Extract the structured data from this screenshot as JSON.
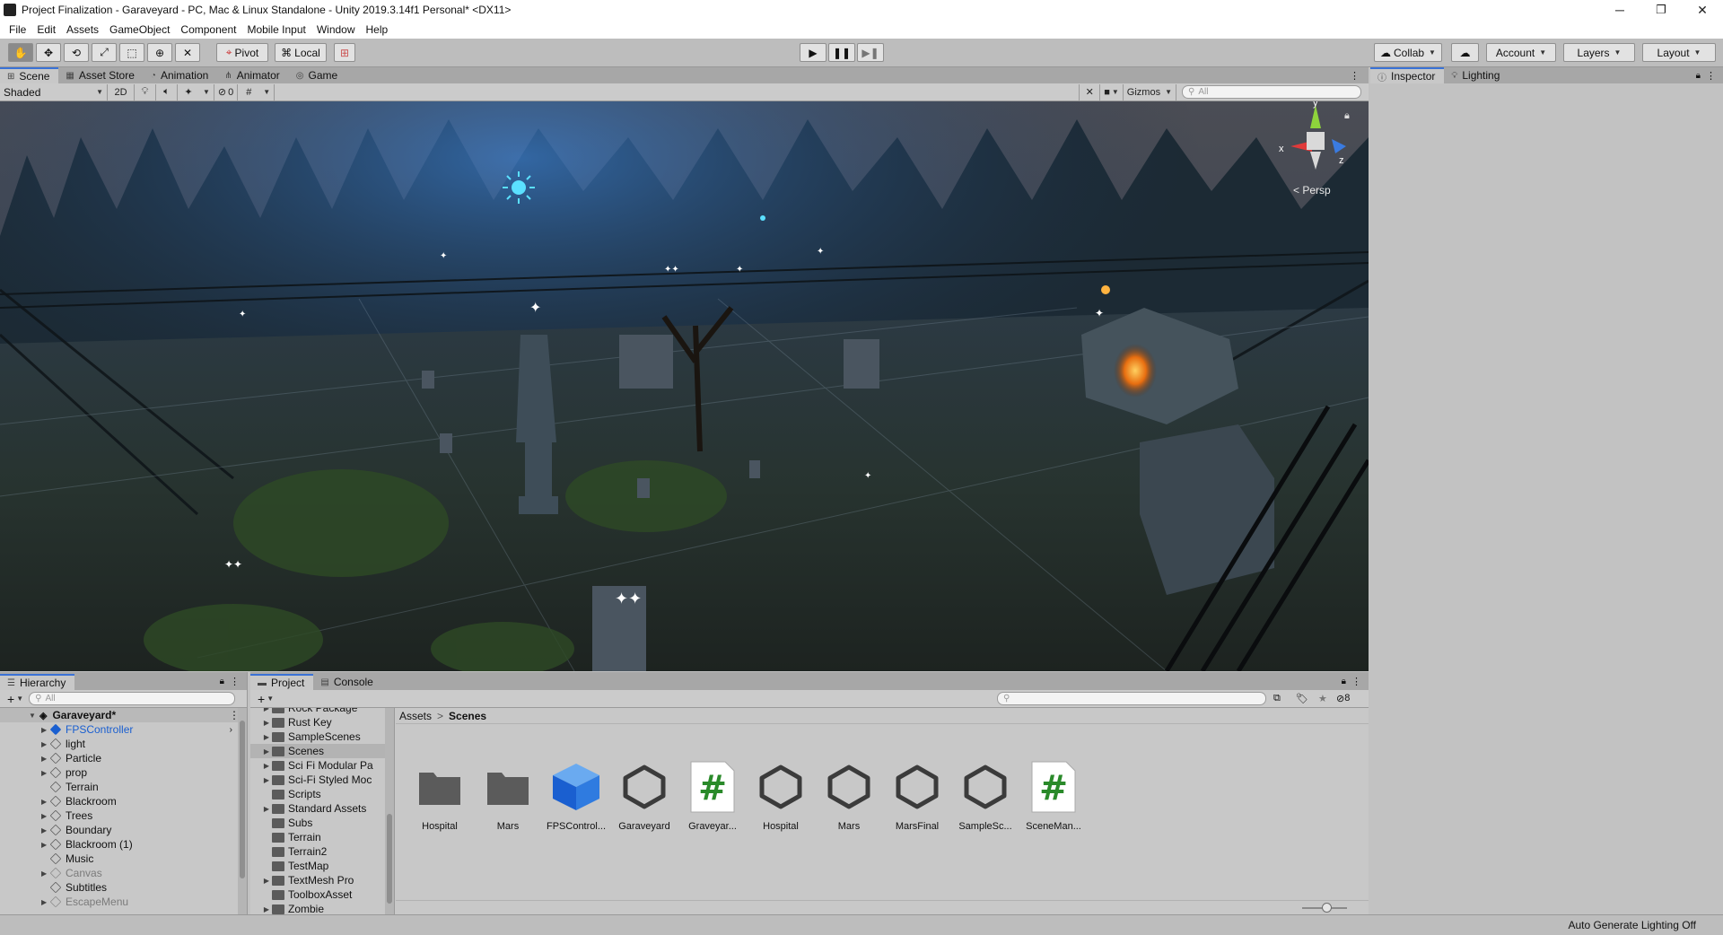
{
  "window": {
    "title": "Project Finalization - Garaveyard - PC, Mac & Linux Standalone - Unity 2019.3.14f1 Personal* <DX11>",
    "minimize": "─",
    "restore": "❐",
    "close": "✕"
  },
  "menu": [
    "File",
    "Edit",
    "Assets",
    "GameObject",
    "Component",
    "Mobile Input",
    "Window",
    "Help"
  ],
  "toolbar": {
    "pivot": "Pivot",
    "local": "Local",
    "collab": "Collab",
    "account": "Account",
    "layers": "Layers",
    "layout": "Layout"
  },
  "scene_tabs": [
    "Scene",
    "Asset Store",
    "Animation",
    "Animator",
    "Game"
  ],
  "scene_bar": {
    "shading": "Shaded",
    "mode_2d": "2D",
    "hidden_count": "0",
    "gizmos": "Gizmos",
    "search_placeholder": "All"
  },
  "viewport": {
    "projection": "< Persp",
    "axis_x": "x",
    "axis_y": "y",
    "axis_z": "z"
  },
  "inspector_tabs": [
    "Inspector",
    "Lighting"
  ],
  "hierarchy": {
    "tab": "Hierarchy",
    "search_placeholder": "All",
    "scene": "Garaveyard*",
    "items": [
      {
        "label": "FPSController",
        "expand": true,
        "style": "prefab"
      },
      {
        "label": "light",
        "expand": true,
        "style": "normal"
      },
      {
        "label": "Particle",
        "expand": true,
        "style": "normal"
      },
      {
        "label": "prop",
        "expand": true,
        "style": "normal"
      },
      {
        "label": "Terrain",
        "expand": false,
        "style": "normal"
      },
      {
        "label": "Blackroom",
        "expand": true,
        "style": "normal"
      },
      {
        "label": "Trees",
        "expand": true,
        "style": "normal"
      },
      {
        "label": "Boundary",
        "expand": true,
        "style": "normal"
      },
      {
        "label": "Blackroom (1)",
        "expand": true,
        "style": "normal"
      },
      {
        "label": "Music",
        "expand": false,
        "style": "normal"
      },
      {
        "label": "Canvas",
        "expand": true,
        "style": "dim"
      },
      {
        "label": "Subtitles",
        "expand": false,
        "style": "normal"
      },
      {
        "label": "EscapeMenu",
        "expand": true,
        "style": "dim"
      }
    ]
  },
  "project": {
    "tab": "Project",
    "console_tab": "Console",
    "hidden_count": "8",
    "breadcrumb_root": "Assets",
    "breadcrumb_sep": ">",
    "breadcrumb_current": "Scenes",
    "folders": [
      {
        "label": "Rock Package",
        "expand": true
      },
      {
        "label": "Rust Key",
        "expand": true
      },
      {
        "label": "SampleScenes",
        "expand": true
      },
      {
        "label": "Scenes",
        "expand": true,
        "selected": true
      },
      {
        "label": "Sci Fi Modular Pa",
        "expand": true
      },
      {
        "label": "Sci-Fi Styled Moc",
        "expand": true
      },
      {
        "label": "Scripts",
        "expand": false
      },
      {
        "label": "Standard Assets",
        "expand": true
      },
      {
        "label": "Subs",
        "expand": false
      },
      {
        "label": "Terrain",
        "expand": false
      },
      {
        "label": "Terrain2",
        "expand": false
      },
      {
        "label": "TestMap",
        "expand": false
      },
      {
        "label": "TextMesh Pro",
        "expand": true
      },
      {
        "label": "ToolboxAsset",
        "expand": false
      },
      {
        "label": "Zombie",
        "expand": true
      }
    ],
    "assets": [
      {
        "label": "Hospital",
        "kind": "folder"
      },
      {
        "label": "Mars",
        "kind": "folder"
      },
      {
        "label": "FPSControl...",
        "kind": "prefab"
      },
      {
        "label": "Garaveyard",
        "kind": "scene"
      },
      {
        "label": "Graveyar...",
        "kind": "script"
      },
      {
        "label": "Hospital",
        "kind": "scene"
      },
      {
        "label": "Mars",
        "kind": "scene"
      },
      {
        "label": "MarsFinal",
        "kind": "scene"
      },
      {
        "label": "SampleSc...",
        "kind": "scene"
      },
      {
        "label": "SceneMan...",
        "kind": "script"
      }
    ]
  },
  "status": {
    "lighting": "Auto Generate Lighting Off"
  },
  "colors": {
    "accent": "#3a72d6",
    "prefab": "#1a5fd0",
    "script_hash": "#2a8a2a"
  }
}
